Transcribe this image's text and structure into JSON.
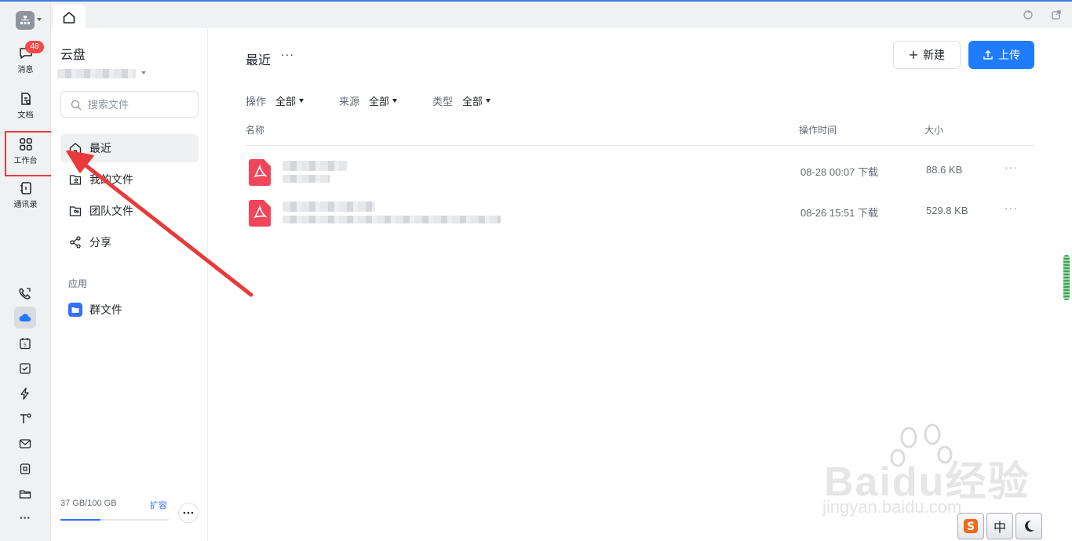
{
  "rail": {
    "message_label": "消息",
    "message_badge": "48",
    "docs_label": "文档",
    "workbench_label": "工作台",
    "contacts_label": "通讯录",
    "more_label": "···"
  },
  "sidebar": {
    "title": "云盘",
    "search_placeholder": "搜索文件",
    "nav": [
      {
        "label": "最近"
      },
      {
        "label": "我的文件"
      },
      {
        "label": "团队文件"
      },
      {
        "label": "分享"
      }
    ],
    "apps_section_label": "应用",
    "apps": [
      {
        "label": "群文件"
      }
    ],
    "storage_text": "37 GB/100 GB",
    "storage_used_fraction": 0.37,
    "expand_label": "扩容"
  },
  "main": {
    "title": "最近",
    "title_more": "···",
    "new_button": "新建",
    "upload_button": "上传",
    "filters": [
      {
        "label": "操作",
        "value": "全部"
      },
      {
        "label": "来源",
        "value": "全部"
      },
      {
        "label": "类型",
        "value": "全部"
      }
    ],
    "columns": {
      "name": "名称",
      "time": "操作时间",
      "size": "大小"
    },
    "rows": [
      {
        "time": "08-28 00:07 下载",
        "size": "88.6 KB",
        "more": "···"
      },
      {
        "time": "08-26 15:51 下载",
        "size": "529.8 KB",
        "more": "···"
      }
    ]
  },
  "watermark": {
    "brand": "Baidu经验",
    "url": "jingyan.baidu.com"
  },
  "ime": {
    "mode": "中"
  },
  "colors": {
    "accent": "#1f7cff",
    "badge": "#f54a45",
    "pdf": "#f0455a",
    "annotation": "#e83a3a"
  }
}
